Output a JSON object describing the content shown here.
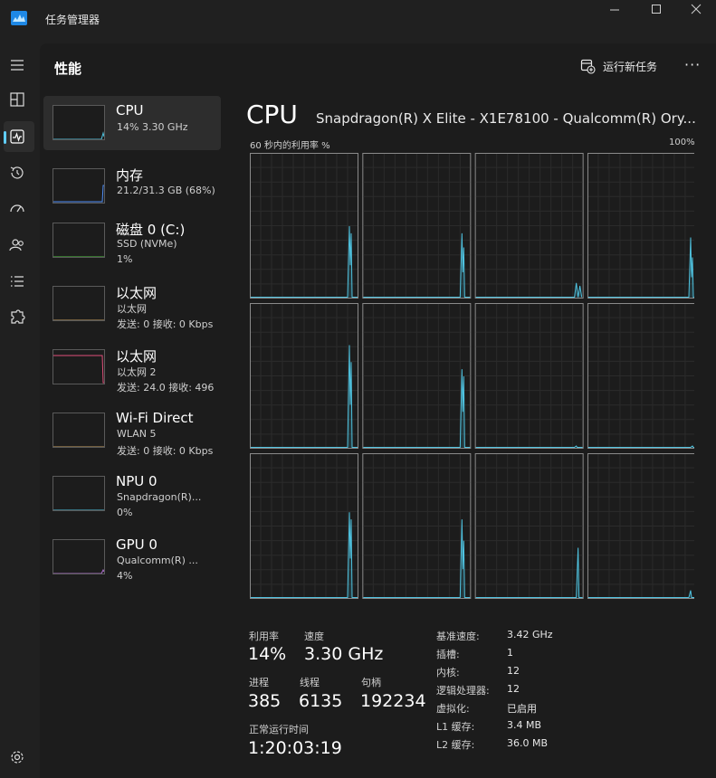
{
  "window": {
    "title": "任务管理器"
  },
  "nav": {
    "items": [
      "hamburger-menu-icon",
      "processes-icon",
      "performance-icon",
      "app-history-icon",
      "startup-apps-icon",
      "users-icon",
      "details-icon",
      "services-icon"
    ],
    "settings": "settings-icon"
  },
  "header": {
    "title": "性能",
    "run_task": "运行新任务",
    "more": "···"
  },
  "sidebar": {
    "items": [
      {
        "title": "CPU",
        "line1": "14%  3.30 GHz",
        "line2": "",
        "graph_color": "#4fc3e0"
      },
      {
        "title": "内存",
        "line1": "21.2/31.3 GB (68%)",
        "line2": "",
        "graph_color": "#4f8ef7"
      },
      {
        "title": "磁盘 0 (C:)",
        "line1": "SSD (NVMe)",
        "line2": "1%",
        "graph_color": "#4ec93e"
      },
      {
        "title": "以太网",
        "line1": "以太网",
        "line2": "发送: 0  接收: 0 Kbps",
        "graph_color": "#c8a060"
      },
      {
        "title": "以太网",
        "line1": "以太网 2",
        "line2": "发送: 24.0  接收: 496",
        "graph_color": "#e0507a"
      },
      {
        "title": "Wi-Fi Direct",
        "line1": "WLAN 5",
        "line2": "发送: 0  接收: 0 Kbps",
        "graph_color": "#c8a060"
      },
      {
        "title": "NPU 0",
        "line1": "Snapdragon(R)...",
        "line2": "0%",
        "graph_color": "#4fc3e0"
      },
      {
        "title": "GPU 0",
        "line1": "Qualcomm(R) ...",
        "line2": "4%",
        "graph_color": "#b070d0"
      }
    ]
  },
  "cpu": {
    "title": "CPU",
    "model": "Snapdragon(R) X Elite - X1E78100 - Qualcomm(R) Ory...",
    "graph_left_label": "60 秒内的利用率 %",
    "graph_right_label": "100%",
    "accent_color": "#4fc3e0",
    "stats": {
      "util_label": "利用率",
      "util_value": "14%",
      "speed_label": "速度",
      "speed_value": "3.30 GHz",
      "proc_label": "进程",
      "proc_value": "385",
      "thread_label": "线程",
      "thread_value": "6135",
      "handle_label": "句柄",
      "handle_value": "192234",
      "uptime_label": "正常运行时间",
      "uptime_value": "1:20:03:19"
    },
    "specs": [
      {
        "k": "基准速度:",
        "v": "3.42 GHz"
      },
      {
        "k": "插槽:",
        "v": "1"
      },
      {
        "k": "内核:",
        "v": "12"
      },
      {
        "k": "逻辑处理器:",
        "v": "12"
      },
      {
        "k": "虚拟化:",
        "v": "已启用"
      },
      {
        "k": "L1 缓存:",
        "v": "3.4 MB"
      },
      {
        "k": "L2 缓存:",
        "v": "36.0 MB"
      }
    ]
  }
}
